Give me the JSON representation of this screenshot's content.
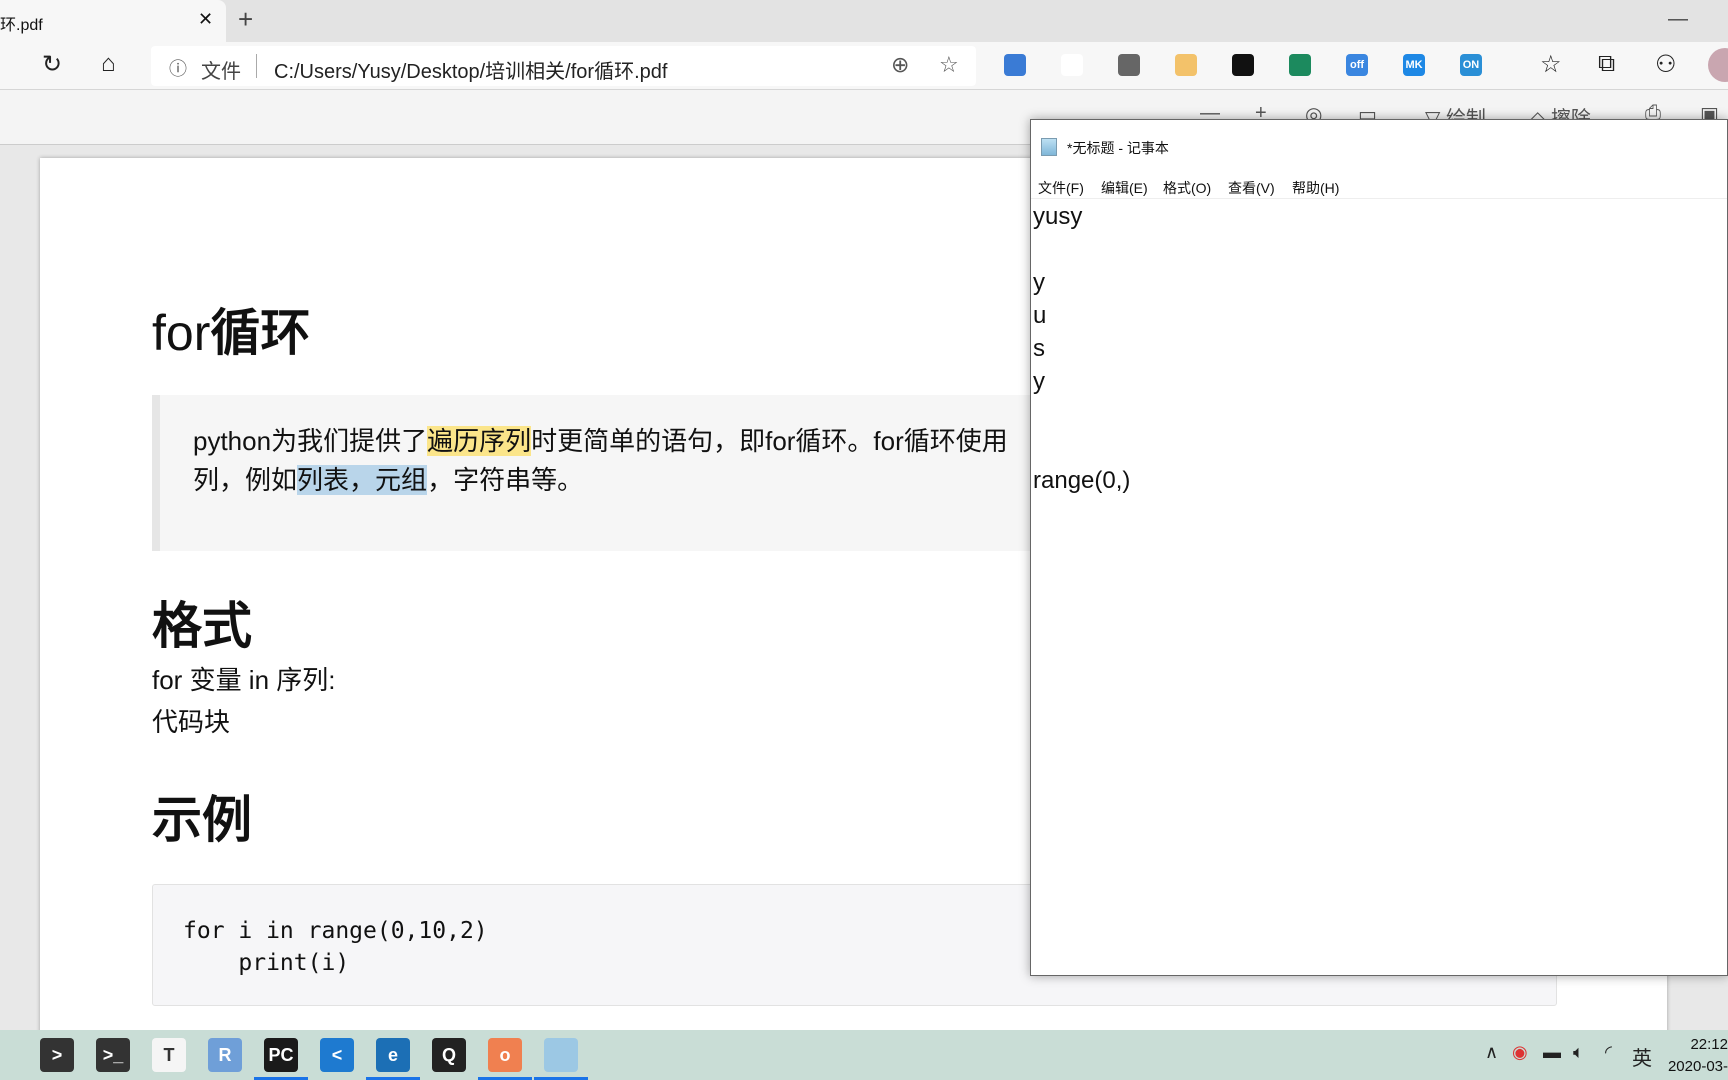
{
  "browser": {
    "tab_title": "环.pdf",
    "address_scheme": "文件",
    "url": "C:/Users/Yusy/Desktop/培训相关/for循环.pdf",
    "extensions": [
      {
        "name": "ext-1",
        "color": "#3a7bd5",
        "label": ""
      },
      {
        "name": "ext-2",
        "color": "#ffffff",
        "label": ""
      },
      {
        "name": "ext-3",
        "color": "#666666",
        "label": ""
      },
      {
        "name": "ext-4",
        "color": "#f3c26a",
        "label": ""
      },
      {
        "name": "ext-5",
        "color": "#111111",
        "label": ""
      },
      {
        "name": "ext-6",
        "color": "#1c8a5e",
        "label": ""
      },
      {
        "name": "ext-7",
        "color": "#3a86e0",
        "label": "off"
      },
      {
        "name": "ext-8",
        "color": "#1e88e5",
        "label": "MK"
      },
      {
        "name": "ext-9",
        "color": "#2a8fd6",
        "label": "ON"
      }
    ],
    "pdf_toolbar": {
      "draw": "绘制",
      "erase": "擦除"
    }
  },
  "pdf": {
    "title_latin": "for",
    "title_cjk": "循环",
    "quote": {
      "p1": "python为我们提供了",
      "h1": "遍历序列",
      "p2": "时更简单的语句，即for循环。for循环使用",
      "p3": "列，例如",
      "h2": "列表",
      "p4": "，",
      "h3": "元组",
      "p5": "，字符串等。"
    },
    "format_heading": "格式",
    "format_line1": "for 变量 in 序列:",
    "format_line2": "代码块",
    "example_heading": "示例",
    "code": "for i in range(0,10,2)\n    print(i)"
  },
  "notepad": {
    "title": "*无标题 - 记事本",
    "menu": [
      "文件(F)",
      "编辑(E)",
      "格式(O)",
      "查看(V)",
      "帮助(H)"
    ],
    "content": "yusy\n\ny\nu\ns\ny\n\n\nrange(0,)"
  },
  "taskbar": {
    "apps": [
      {
        "name": "taskbar-app-1",
        "color": "#333",
        "label": ">"
      },
      {
        "name": "taskbar-terminal",
        "color": "#333",
        "label": ">_"
      },
      {
        "name": "taskbar-typora",
        "color": "#f5f5f5",
        "label": "T"
      },
      {
        "name": "taskbar-r",
        "color": "#6f9fd8",
        "label": "R"
      },
      {
        "name": "taskbar-pycharm",
        "color": "#1a1a1a",
        "label": "PC"
      },
      {
        "name": "taskbar-vscode",
        "color": "#1e7ad0",
        "label": "<"
      },
      {
        "name": "taskbar-edge-beta",
        "color": "#1c6fb5",
        "label": "e"
      },
      {
        "name": "taskbar-qq",
        "color": "#222",
        "label": "Q"
      },
      {
        "name": "taskbar-app-9",
        "color": "#f08050",
        "label": "o"
      },
      {
        "name": "taskbar-notepad",
        "color": "#9cc8e4",
        "label": ""
      }
    ],
    "ime": "英",
    "time": "22:12",
    "date": "2020-03-"
  }
}
